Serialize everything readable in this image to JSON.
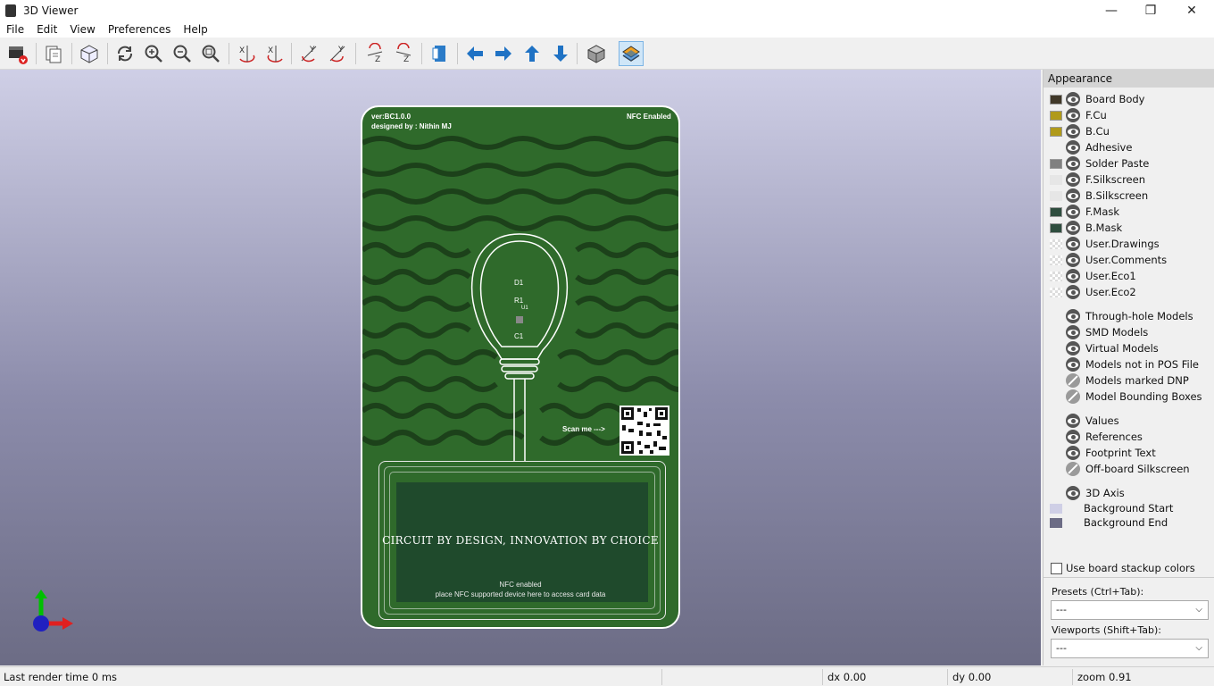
{
  "window": {
    "title": "3D Viewer"
  },
  "menu": [
    "File",
    "Edit",
    "View",
    "Preferences",
    "Help"
  ],
  "toolbar": {
    "buttons": [
      "reload-board-icon",
      "copy-image-icon",
      "raytrace-icon",
      "redraw-icon",
      "zoom-in-icon",
      "zoom-out-icon",
      "zoom-fit-icon",
      "rotate-x-cw-icon",
      "rotate-x-ccw-icon",
      "rotate-y-cw-icon",
      "rotate-y-ccw-icon",
      "rotate-z-cw-icon",
      "rotate-z-ccw-icon",
      "flip-board-icon",
      "pan-left-icon",
      "pan-right-icon",
      "pan-up-icon",
      "pan-down-icon",
      "ortho-view-icon",
      "layers-manager-icon"
    ]
  },
  "board": {
    "version": "ver:BC1.0.0",
    "designer": "designed by : Nithin MJ",
    "nfc_badge": "NFC Enabled",
    "scan_me": "Scan me --->",
    "slogan": "CIRCUIT BY DESIGN, INNOVATION BY CHOICE",
    "nfc_line1": "NFC enabled",
    "nfc_line2": "place NFC supported device here to access card data",
    "refs": {
      "d1": "D1",
      "r1": "R1",
      "u1": "U1",
      "c1": "C1"
    },
    "colors": {
      "soldermask": "#2f6a2b",
      "nfc_area": "#1f4a2c",
      "silk": "#ffffff"
    }
  },
  "panel": {
    "title": "Appearance",
    "layers": [
      {
        "label": "Board Body",
        "color": "#403828",
        "visible": true
      },
      {
        "label": "F.Cu",
        "color": "#b09a1a",
        "visible": true
      },
      {
        "label": "B.Cu",
        "color": "#b09a1a",
        "visible": true
      },
      {
        "label": "Adhesive",
        "color": "",
        "visible": true
      },
      {
        "label": "Solder Paste",
        "color": "#808080",
        "visible": true
      },
      {
        "label": "F.Silkscreen",
        "color": "#e6e6e6",
        "visible": true
      },
      {
        "label": "B.Silkscreen",
        "color": "#e6e6e6",
        "visible": true
      },
      {
        "label": "F.Mask",
        "color": "#2e4d3e",
        "visible": true
      },
      {
        "label": "B.Mask",
        "color": "#2e4d3e",
        "visible": true
      },
      {
        "label": "User.Drawings",
        "color": "checker",
        "visible": true
      },
      {
        "label": "User.Comments",
        "color": "checker",
        "visible": true
      },
      {
        "label": "User.Eco1",
        "color": "checker",
        "visible": true
      },
      {
        "label": "User.Eco2",
        "color": "checker",
        "visible": true
      }
    ],
    "models": [
      {
        "label": "Through-hole Models",
        "visible": true
      },
      {
        "label": "SMD Models",
        "visible": true
      },
      {
        "label": "Virtual Models",
        "visible": true
      },
      {
        "label": "Models not in POS File",
        "visible": true
      },
      {
        "label": "Models marked DNP",
        "visible": false
      },
      {
        "label": "Model Bounding Boxes",
        "visible": false
      }
    ],
    "text": [
      {
        "label": "Values",
        "visible": true
      },
      {
        "label": "References",
        "visible": true
      },
      {
        "label": "Footprint Text",
        "visible": true
      },
      {
        "label": "Off-board Silkscreen",
        "visible": false
      }
    ],
    "axis": {
      "label": "3D Axis",
      "visible": true
    },
    "background": [
      {
        "label": "Background Start",
        "color": "#cfcfe6"
      },
      {
        "label": "Background End",
        "color": "#6c6c85"
      }
    ],
    "use_stackup": "Use board stackup colors",
    "presets_label": "Presets (Ctrl+Tab):",
    "presets_value": "---",
    "viewports_label": "Viewports (Shift+Tab):",
    "viewports_value": "---"
  },
  "status": {
    "render": "Last render time 0 ms",
    "dx": "dx 0.00",
    "dy": "dy 0.00",
    "zoom": "zoom 0.91"
  }
}
